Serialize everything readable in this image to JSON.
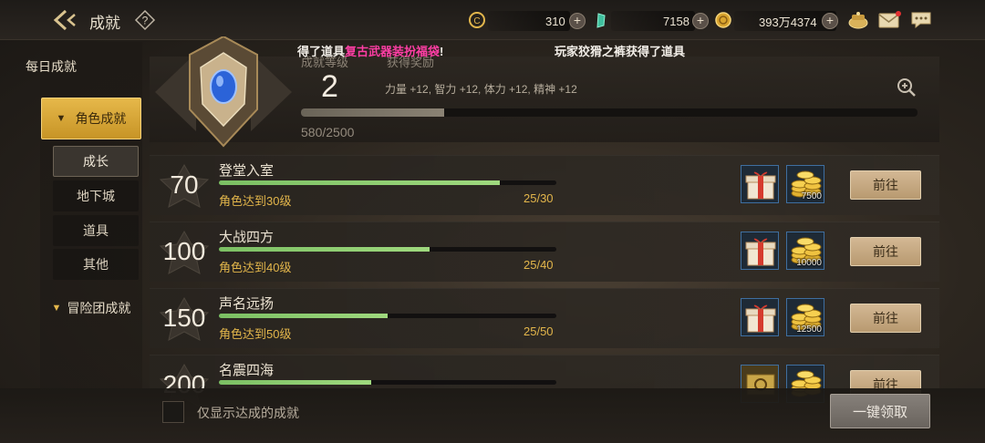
{
  "header": {
    "title": "成就",
    "currencies": [
      {
        "value": "310"
      },
      {
        "value": "7158"
      },
      {
        "value": "393万4374"
      }
    ]
  },
  "ticker": {
    "left_prefix": "得了道具",
    "left_item": "复古武器装扮福袋",
    "left_suffix": "!",
    "right": "玩家狡猾之裤获得了道具"
  },
  "sidebar": {
    "daily": "每日成就",
    "role": "角色成就",
    "subs": [
      "成长",
      "地下城",
      "道具",
      "其他"
    ],
    "adventure": "冒险团成就"
  },
  "summary": {
    "level_label": "成就等级",
    "reward_label": "获得奖励",
    "level": "2",
    "bonus": "力量 +12, 智力 +12, 体力 +12, 精神 +12",
    "progress_text": "580/2500",
    "progress": 0.232
  },
  "rows": [
    {
      "points": "70",
      "name": "登堂入室",
      "req": "角色达到30级",
      "prog": "25/30",
      "ratio": 0.833,
      "gold": "7500"
    },
    {
      "points": "100",
      "name": "大战四方",
      "req": "角色达到40级",
      "prog": "25/40",
      "ratio": 0.625,
      "gold": "10000"
    },
    {
      "points": "150",
      "name": "声名远扬",
      "req": "角色达到50级",
      "prog": "25/50",
      "ratio": 0.5,
      "gold": "12500"
    },
    {
      "points": "200",
      "name": "名震四海",
      "req": "",
      "prog": "",
      "ratio": 0.45,
      "gold": ""
    }
  ],
  "go_label": "前往",
  "footer": {
    "filter_label": "仅显示达成的成就",
    "claim_all": "一键领取"
  },
  "colors": {
    "accent_gold": "#e3b64b",
    "progress_green": "#8ccd6c",
    "ticker_highlight": "#ff3ea5"
  }
}
